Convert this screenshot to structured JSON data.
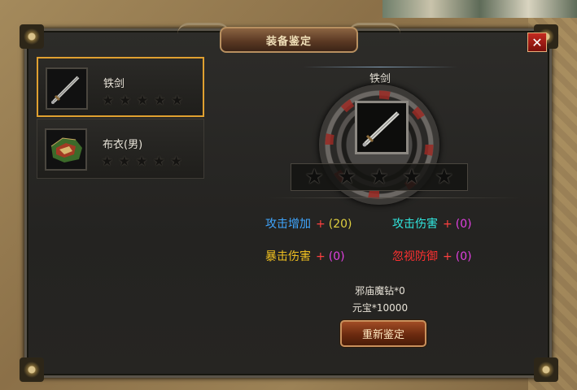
{
  "window": {
    "title": "装备鉴定",
    "close_label": "✕"
  },
  "items": [
    {
      "name": "铁剑",
      "stars": 5,
      "icon": "iron-sword-icon",
      "selected": true
    },
    {
      "name": "布衣(男)",
      "stars": 5,
      "icon": "cloth-armor-icon",
      "selected": false
    }
  ],
  "detail": {
    "item_name": "铁剑",
    "icon": "iron-sword-icon",
    "stars_total": 5,
    "stars_filled": 0
  },
  "stats": [
    {
      "label": "攻击增加",
      "plus": "+",
      "value": "(20)",
      "label_color": "#3fa6ff",
      "value_color": "#e0d040"
    },
    {
      "label": "攻击伤害",
      "plus": "+",
      "value": "(0)",
      "label_color": "#30e8e0",
      "value_color": "#e040e0"
    },
    {
      "label": "暴击伤害",
      "plus": "+",
      "value": "(0)",
      "label_color": "#f0c020",
      "value_color": "#e040e0"
    },
    {
      "label": "忽视防御",
      "plus": "+",
      "value": "(0)",
      "label_color": "#ff3030",
      "value_color": "#e040e0"
    }
  ],
  "costs": {
    "material": "邪庙魔钻*0",
    "currency": "元宝*10000"
  },
  "buttons": {
    "reidentify": "重新鉴定"
  }
}
